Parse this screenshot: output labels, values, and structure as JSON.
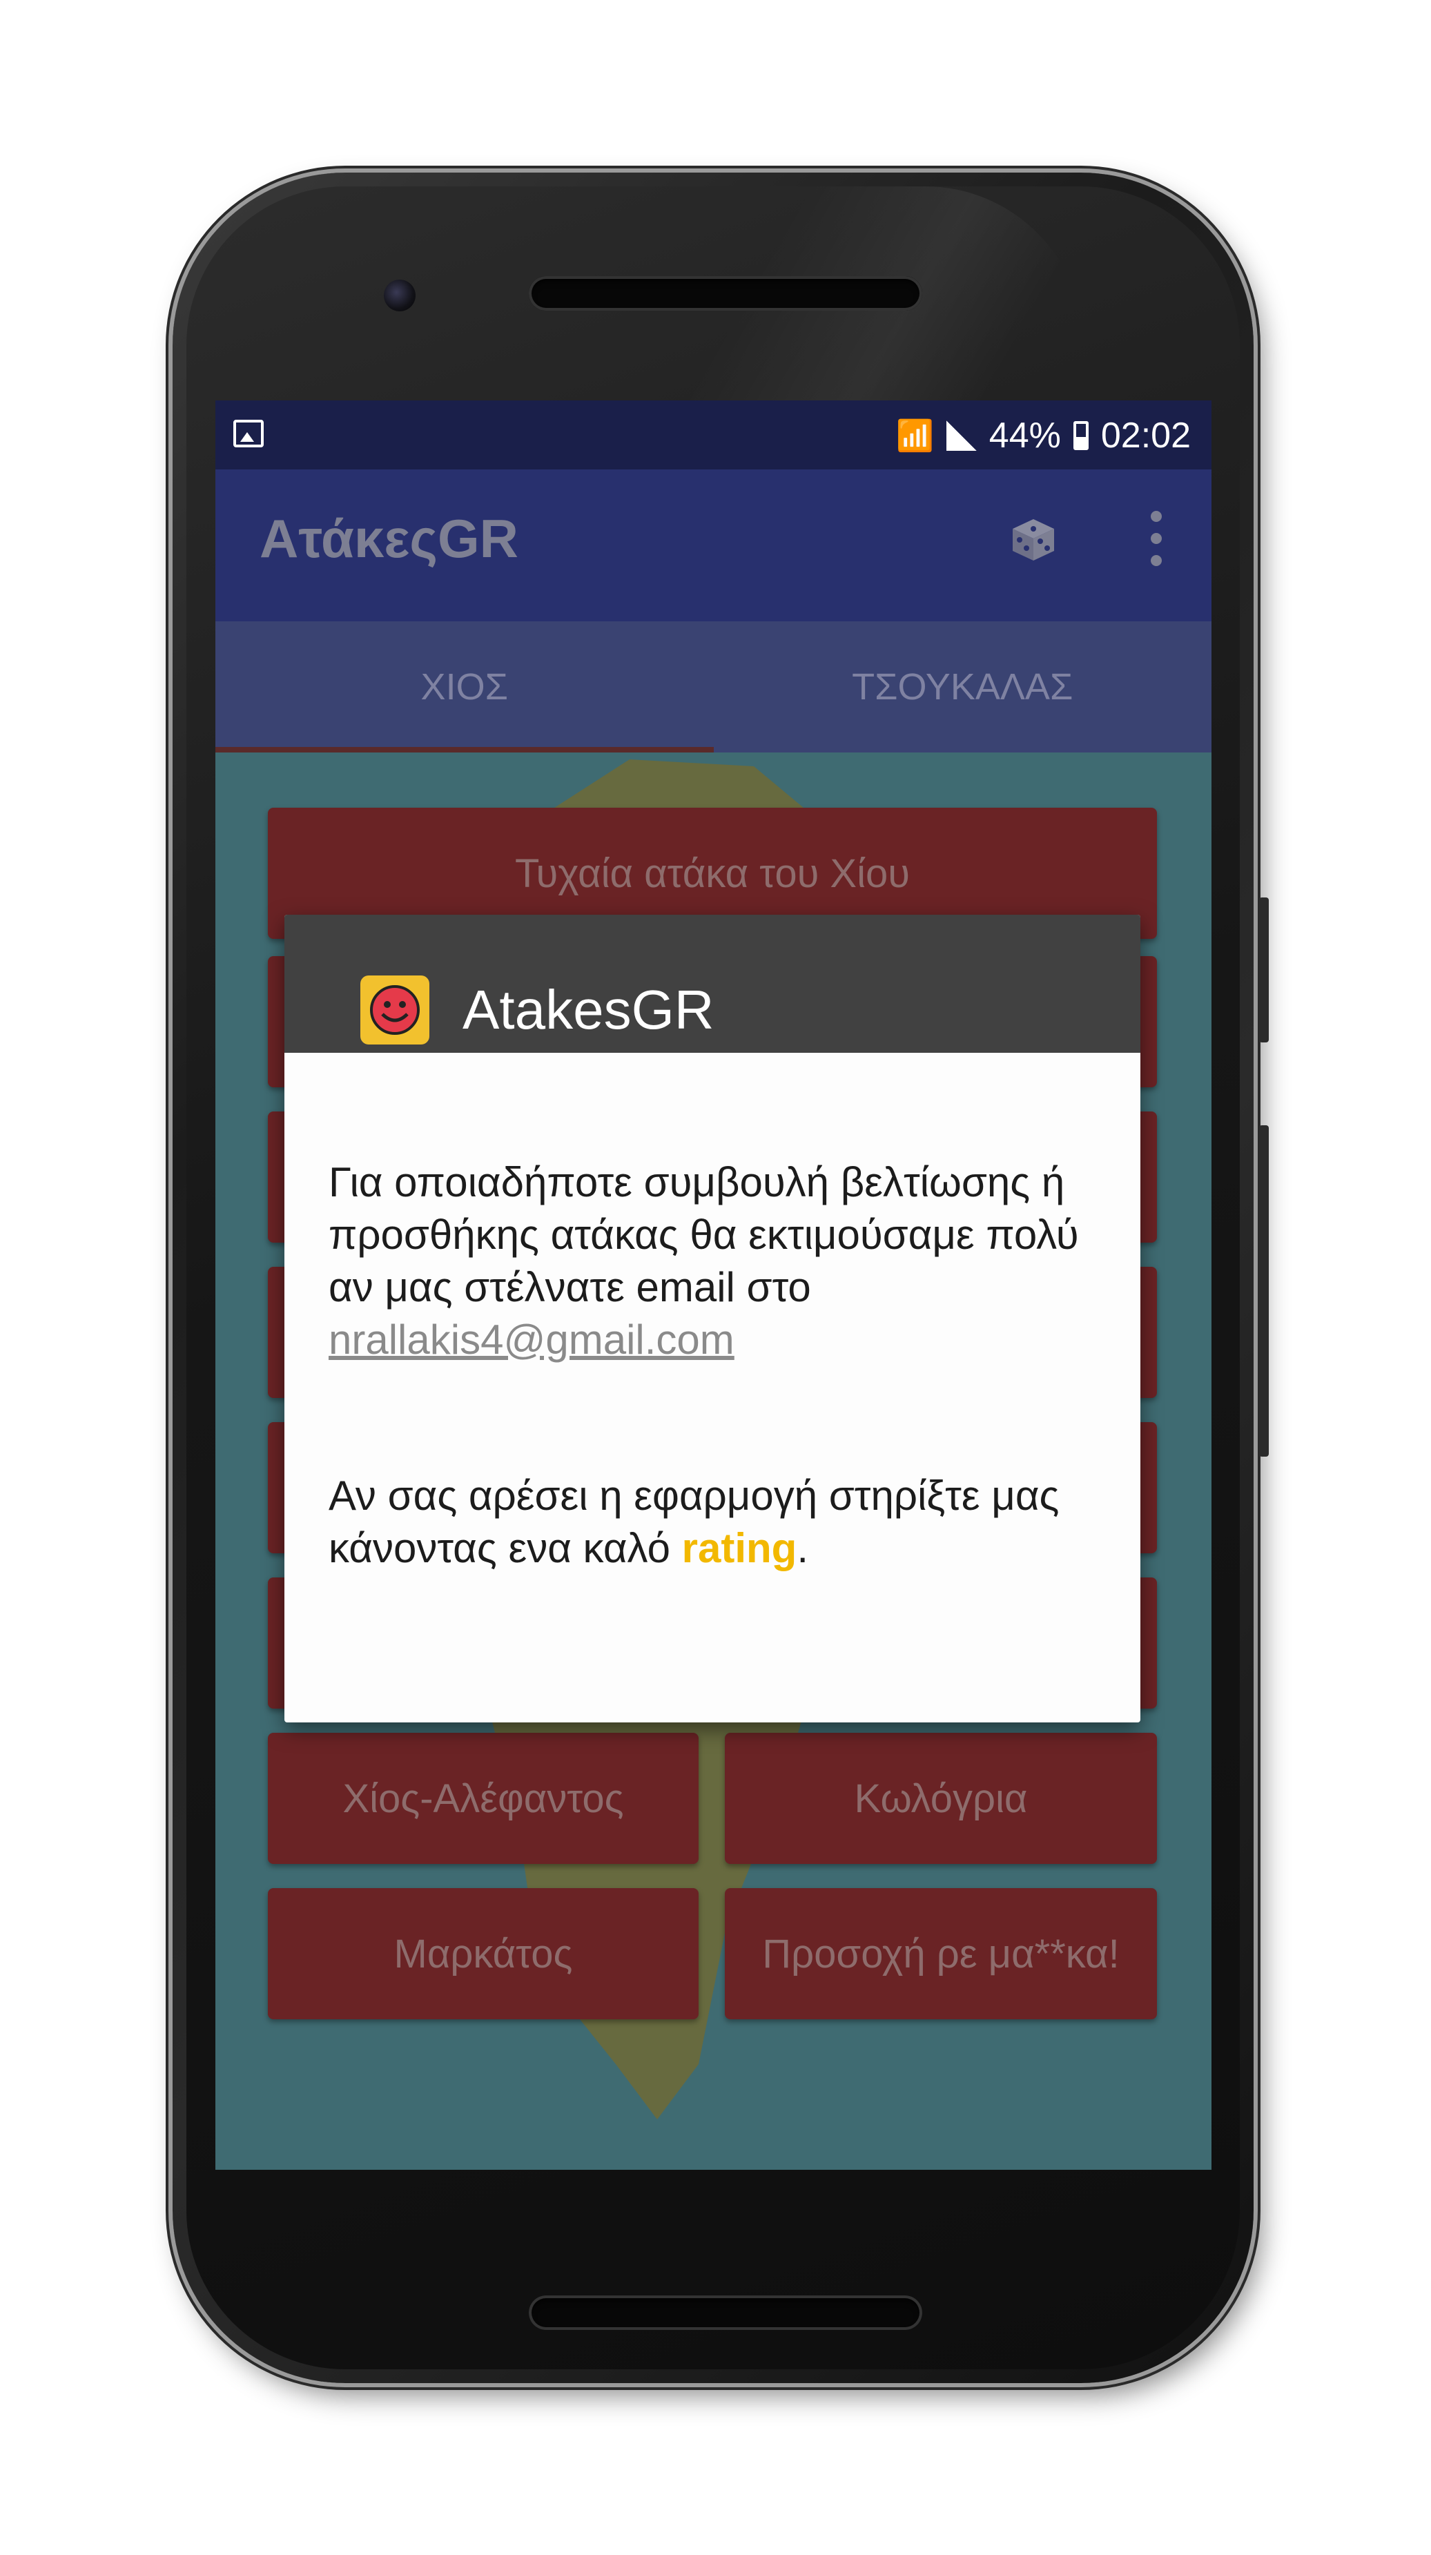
{
  "status_bar": {
    "battery": "44%",
    "time": "02:02"
  },
  "app_bar": {
    "title": "ΑτάκεςGR"
  },
  "tabs": [
    {
      "label": "ΧΙΟΣ",
      "active": true
    },
    {
      "label": "ΤΣΟΥΚΑΛΑΣ",
      "active": false
    }
  ],
  "buttons": {
    "random": "Τυχαία ατάκα του Χίου",
    "xios_alefantos": "Χίος-Αλέφαντος",
    "kologria": "Κωλόγρια",
    "markatos": "Μαρκάτος",
    "prosoxi": "Προσοχή ρε μα**κα!"
  },
  "dialog": {
    "title": "AtakesGR",
    "paragraph1": "Για οποιαδήποτε συμβουλή βελτίωσης ή προσθήκης ατάκας θα εκτιμούσαμε πολύ αν μας στέλνατε email στο ",
    "email": "nrallakis4@gmail.com",
    "paragraph2": "Αν σας αρέσει η εφαρμογή στηρίξτε μας κάνοντας ενα καλό ",
    "rating": "rating",
    "paragraph2_end": "."
  },
  "colors": {
    "status_bar": "#1a1f4a",
    "app_bar": "#28306e",
    "tabs": "#3a4372",
    "button": "#6a2325",
    "dialog_header": "#414141",
    "rating": "#f2b800"
  }
}
